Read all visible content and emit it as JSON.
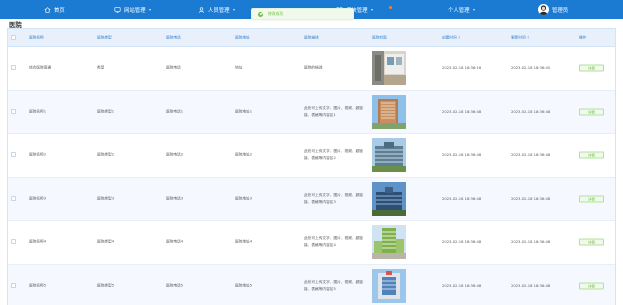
{
  "nav": {
    "home": "首页",
    "site": "网站管理",
    "people": "人员管理",
    "module": "模块管理",
    "personal": "个人管理",
    "user": "管理员"
  },
  "toast": {
    "text": "修改成功"
  },
  "page": {
    "title": "医院"
  },
  "table": {
    "headers": {
      "name": "医院名称",
      "type": "医院类型",
      "phone": "医院电话",
      "address": "医院地址",
      "desc": "医院描述",
      "image": "医院封面",
      "created": "创建时间",
      "updated": "更新时间",
      "op": "操作"
    },
    "sort_glyph": "⇕",
    "detail_label": "详情",
    "rows": [
      {
        "name": "综合医院南通",
        "type": "类型",
        "phone": "医院电话",
        "address": "地址",
        "desc": "医院的描述",
        "created": "2023-02-18 18:36:16",
        "updated": "2023-02-18 18:36:45"
      },
      {
        "name": "医院名称1",
        "type": "医院类型1",
        "phone": "医院电话1",
        "address": "医院地址1",
        "desc": "此处可上传文字、图片、视频、超链接、表格等内容区1",
        "created": "2023-02-18 18:36:48",
        "updated": "2023-02-18 18:36:48"
      },
      {
        "name": "医院名称2",
        "type": "医院类型2",
        "phone": "医院电话2",
        "address": "医院地址2",
        "desc": "此处可上传文字、图片、视频、超链接、表格等内容区2",
        "created": "2023-02-18 18:36:48",
        "updated": "2023-02-18 18:36:48"
      },
      {
        "name": "医院名称3",
        "type": "医院类型3",
        "phone": "医院电话3",
        "address": "医院地址3",
        "desc": "此处可上传文字、图片、视频、超链接、表格等内容区3",
        "created": "2023-02-18 18:36:48",
        "updated": "2023-02-18 18:36:48"
      },
      {
        "name": "医院名称4",
        "type": "医院类型4",
        "phone": "医院电话4",
        "address": "医院地址4",
        "desc": "此处可上传文字、图片、视频、超链接、表格等内容区4",
        "created": "2023-02-18 18:36:48",
        "updated": "2023-02-18 18:36:48"
      },
      {
        "name": "医院名称5",
        "type": "医院类型5",
        "phone": "医院电话5",
        "address": "医院地址5",
        "desc": "此处可上传文字、图片、视频、超链接、表格等内容区5",
        "created": "2023-02-18 18:36:48",
        "updated": "2023-02-18 18:36:48"
      }
    ]
  },
  "colors": {
    "nav_bg": "#1b7bd3",
    "header_bg": "#e8f1fb",
    "header_text": "#2e79c9",
    "success": "#67c23a",
    "badge": "#ff7a2e"
  },
  "icons": {
    "home": "home-icon",
    "site": "monitor-icon",
    "people": "user-icon",
    "module": "grid-icon",
    "toast": "check-circle-icon"
  }
}
